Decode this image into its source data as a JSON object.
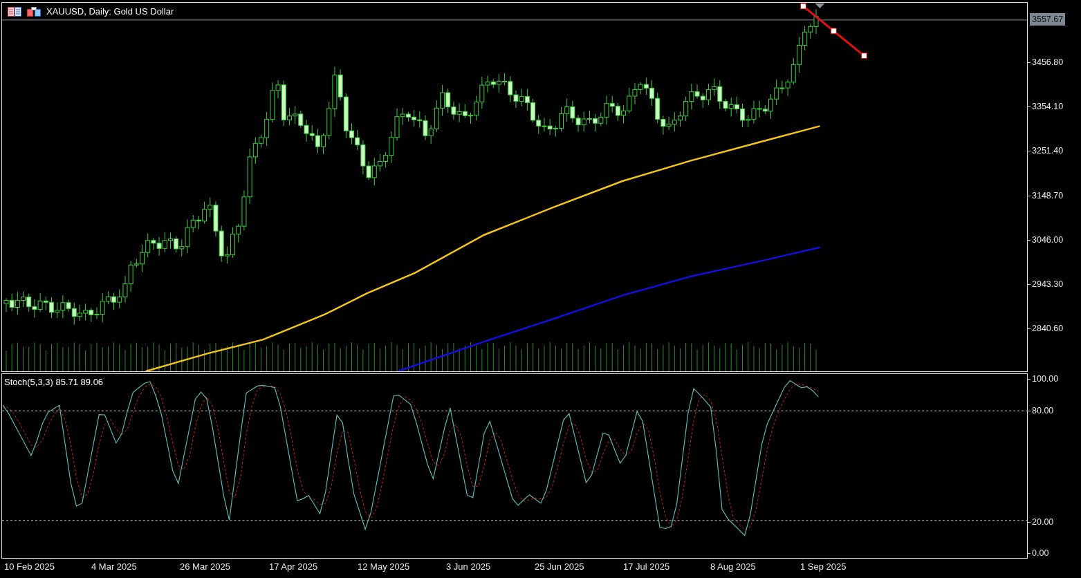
{
  "chart": {
    "title": "XAUUSD, Daily:  Gold US Dollar"
  },
  "price_axis": {
    "current_price": "3557.67",
    "labels": [
      "3456.80",
      "3354.10",
      "3251.40",
      "3148.70",
      "3046.00",
      "2943.30",
      "2840.60"
    ]
  },
  "stochastic": {
    "legend": "Stoch(5,3,3) 85.71 89.06",
    "axis_labels": [
      "100.00",
      "0.00"
    ],
    "levels": [
      "80.00",
      "20.00"
    ]
  },
  "time_axis": {
    "labels": [
      "10 Feb 2025",
      "4 Mar 2025",
      "26 Mar 2025",
      "17 Apr 2025",
      "12 May 2025",
      "3 Jun 2025",
      "25 Jun 2025",
      "17 Jul 2025",
      "8 Aug 2025",
      "1 Sep 2025"
    ]
  }
}
